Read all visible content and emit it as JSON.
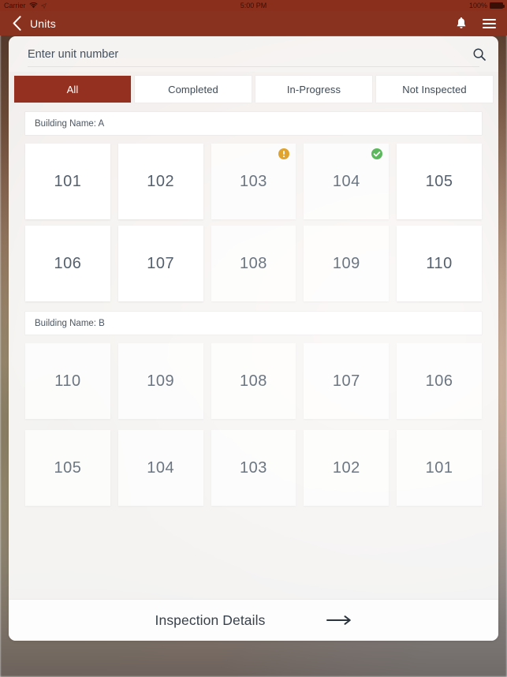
{
  "status_bar": {
    "carrier": "Carrier",
    "wifi_icon": "wifi-icon",
    "time": "5:00 PM",
    "battery_percent": "100%",
    "battery_icon": "battery-full-icon"
  },
  "nav_bar": {
    "back_icon": "chevron-left-icon",
    "title": "Units",
    "bell_icon": "bell-icon",
    "menu_icon": "hamburger-menu-icon",
    "background_color": "#8a3220"
  },
  "search": {
    "placeholder": "Enter unit number",
    "value": "",
    "icon": "search-icon"
  },
  "tabs": [
    {
      "label": "All",
      "active": true
    },
    {
      "label": "Completed",
      "active": false
    },
    {
      "label": "In-Progress",
      "active": false
    },
    {
      "label": "Not Inspected",
      "active": false
    }
  ],
  "tab_active_color": "#943020",
  "buildings": [
    {
      "header": "Building Name: A",
      "units": [
        {
          "number": "101",
          "status": "none"
        },
        {
          "number": "102",
          "status": "none"
        },
        {
          "number": "103",
          "status": "in-progress"
        },
        {
          "number": "104",
          "status": "completed"
        },
        {
          "number": "105",
          "status": "none"
        },
        {
          "number": "106",
          "status": "none"
        },
        {
          "number": "107",
          "status": "none"
        },
        {
          "number": "108",
          "status": "none"
        },
        {
          "number": "109",
          "status": "none"
        },
        {
          "number": "110",
          "status": "none"
        }
      ]
    },
    {
      "header": "Building Name: B",
      "units": [
        {
          "number": "110",
          "status": "none"
        },
        {
          "number": "109",
          "status": "none"
        },
        {
          "number": "108",
          "status": "none"
        },
        {
          "number": "107",
          "status": "none"
        },
        {
          "number": "106",
          "status": "none"
        },
        {
          "number": "105",
          "status": "none"
        },
        {
          "number": "104",
          "status": "none"
        },
        {
          "number": "103",
          "status": "none"
        },
        {
          "number": "102",
          "status": "none"
        },
        {
          "number": "101",
          "status": "none"
        }
      ]
    }
  ],
  "status_colors": {
    "in_progress": "#e0a32e",
    "completed": "#5cb85c"
  },
  "footer": {
    "label": "Inspection Details",
    "arrow_icon": "arrow-right-icon"
  }
}
